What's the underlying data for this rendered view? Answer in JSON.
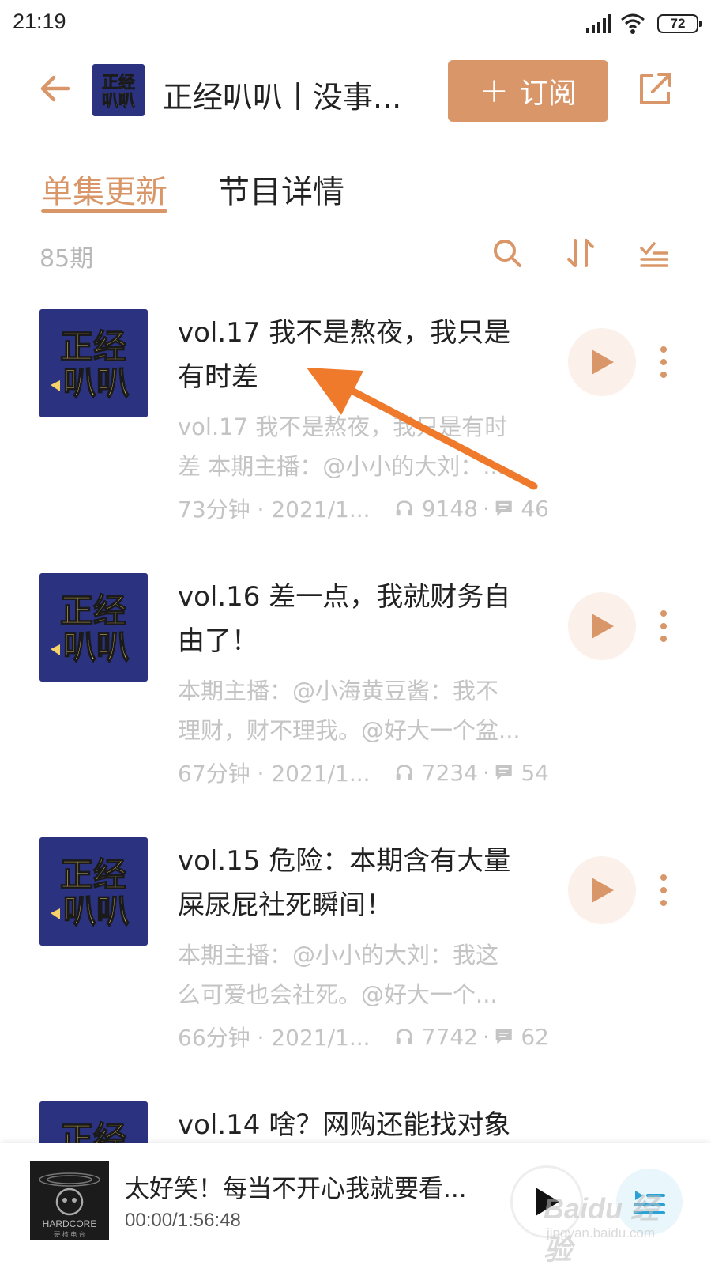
{
  "status_bar": {
    "time": "21:19",
    "battery": "72",
    "icons": [
      "signal-icon",
      "wifi-icon",
      "battery-icon"
    ]
  },
  "header": {
    "back_icon": "arrow-left-icon",
    "logo_text_top": "正经",
    "logo_text_bottom": "叭叭",
    "title": "正经叭叭丨没事...",
    "subscribe_plus": "+",
    "subscribe_label": "订阅",
    "share_icon": "share-icon"
  },
  "tabs": [
    {
      "label": "单集更新",
      "active": true
    },
    {
      "label": "节目详情",
      "active": false
    }
  ],
  "toolbar": {
    "count": "85期",
    "icons": [
      "search-icon",
      "sort-icon",
      "filter-list-icon"
    ]
  },
  "episodes": [
    {
      "title_line1": "vol.17 我不是熬夜，我只是",
      "title_line2": "有时差",
      "desc_line1": "vol.17 我不是熬夜，我只是有时",
      "desc_line2": "差 本期主播：@小小的大刘：...",
      "duration_date": "73分钟 · 2021/1...",
      "plays": "9148",
      "comments": "46"
    },
    {
      "title_line1": "vol.16 差一点，我就财务自",
      "title_line2": "由了！",
      "desc_line1": "本期主播：@小海黄豆酱：我不",
      "desc_line2": "理财，财不理我。@好大一个盆...",
      "duration_date": "67分钟 · 2021/1...",
      "plays": "7234",
      "comments": "54"
    },
    {
      "title_line1": "vol.15 危险：本期含有大量",
      "title_line2": "屎尿屁社死瞬间！",
      "desc_line1": "本期主播：@小小的大刘：我这",
      "desc_line2": "么可爱也会社死。@好大一个...",
      "duration_date": "66分钟 · 2021/1...",
      "plays": "7742",
      "comments": "62"
    },
    {
      "title_line1": "vol.14 啥？网购还能找对象",
      "title_line2": "",
      "desc_line1": "",
      "desc_line2": "",
      "duration_date": "",
      "plays": "",
      "comments": ""
    }
  ],
  "player": {
    "cover_text": "HARDCORE",
    "cover_subtext": "硬 核 电 台",
    "track_title": "太好笑！每当不开心我就要看...",
    "progress": "00:00/1:56:48",
    "play_icon": "play-icon",
    "playlist_icon": "playlist-icon"
  },
  "watermark": {
    "brand": "Baidu 经验",
    "url": "jingyan.baidu.com"
  },
  "colors": {
    "accent": "#d99769",
    "cover_bg": "#2b3380",
    "cover_text": "#f6d268",
    "annotation": "#f07a2c",
    "muted": "#c4c4c4"
  }
}
